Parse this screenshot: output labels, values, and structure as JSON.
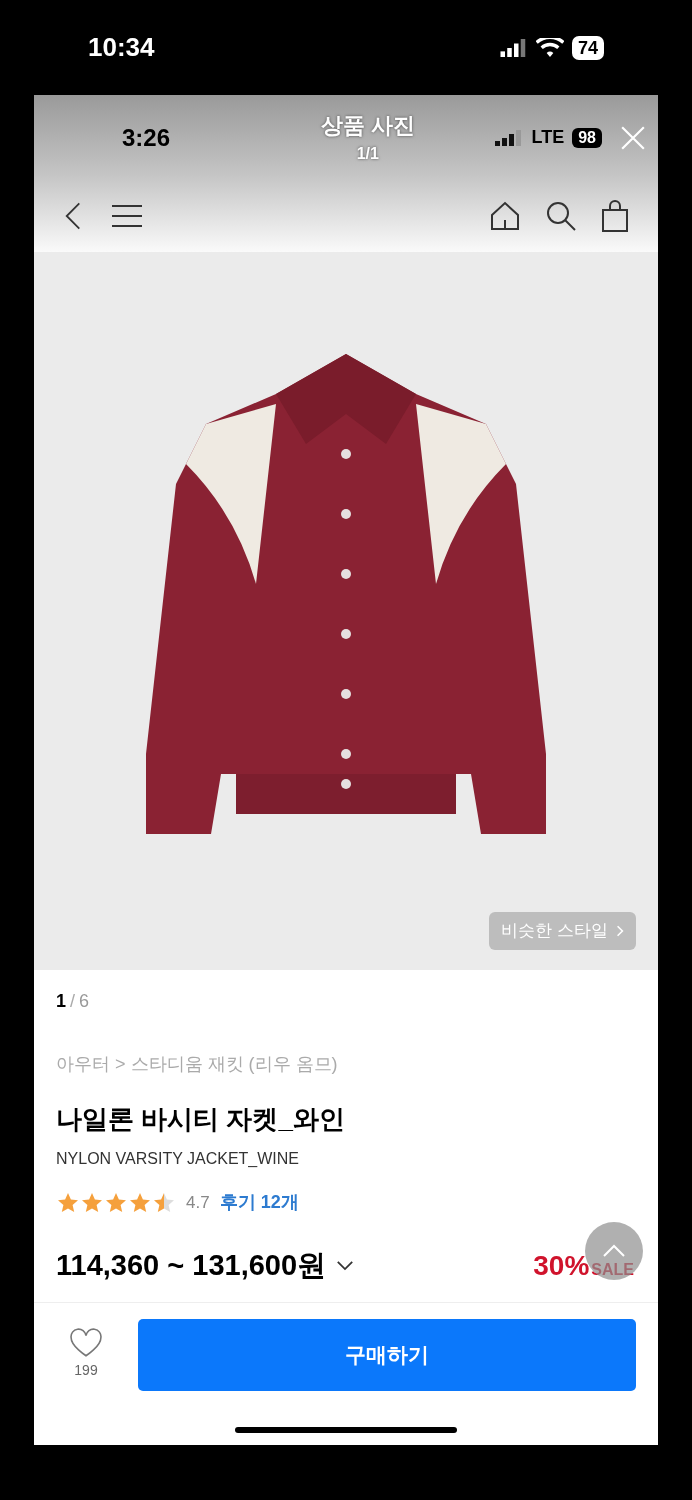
{
  "phone_status": {
    "time": "10:34",
    "battery": "74"
  },
  "viewer": {
    "status_time": "3:26",
    "title": "상품 사진",
    "counter": "1/1",
    "network": "LTE",
    "battery": "98"
  },
  "gallery": {
    "similar_button": "비슷한 스타일",
    "pager": {
      "current": "1",
      "separator": "/",
      "total": "6"
    }
  },
  "product": {
    "breadcrumb": "아우터 > 스타디움 재킷 (리우 옴므)",
    "name": "나일론 바시티 자켓_와인",
    "name_en": "NYLON VARSITY JACKET_WINE",
    "stars": 4.5,
    "rating": "4.7",
    "reviews": "후기 12개",
    "price": "114,360 ~ 131,600원",
    "discount": "30%",
    "sale": "SALE"
  },
  "bottom_bar": {
    "likes": "199",
    "liked": false,
    "buy_button": "구매하기"
  }
}
